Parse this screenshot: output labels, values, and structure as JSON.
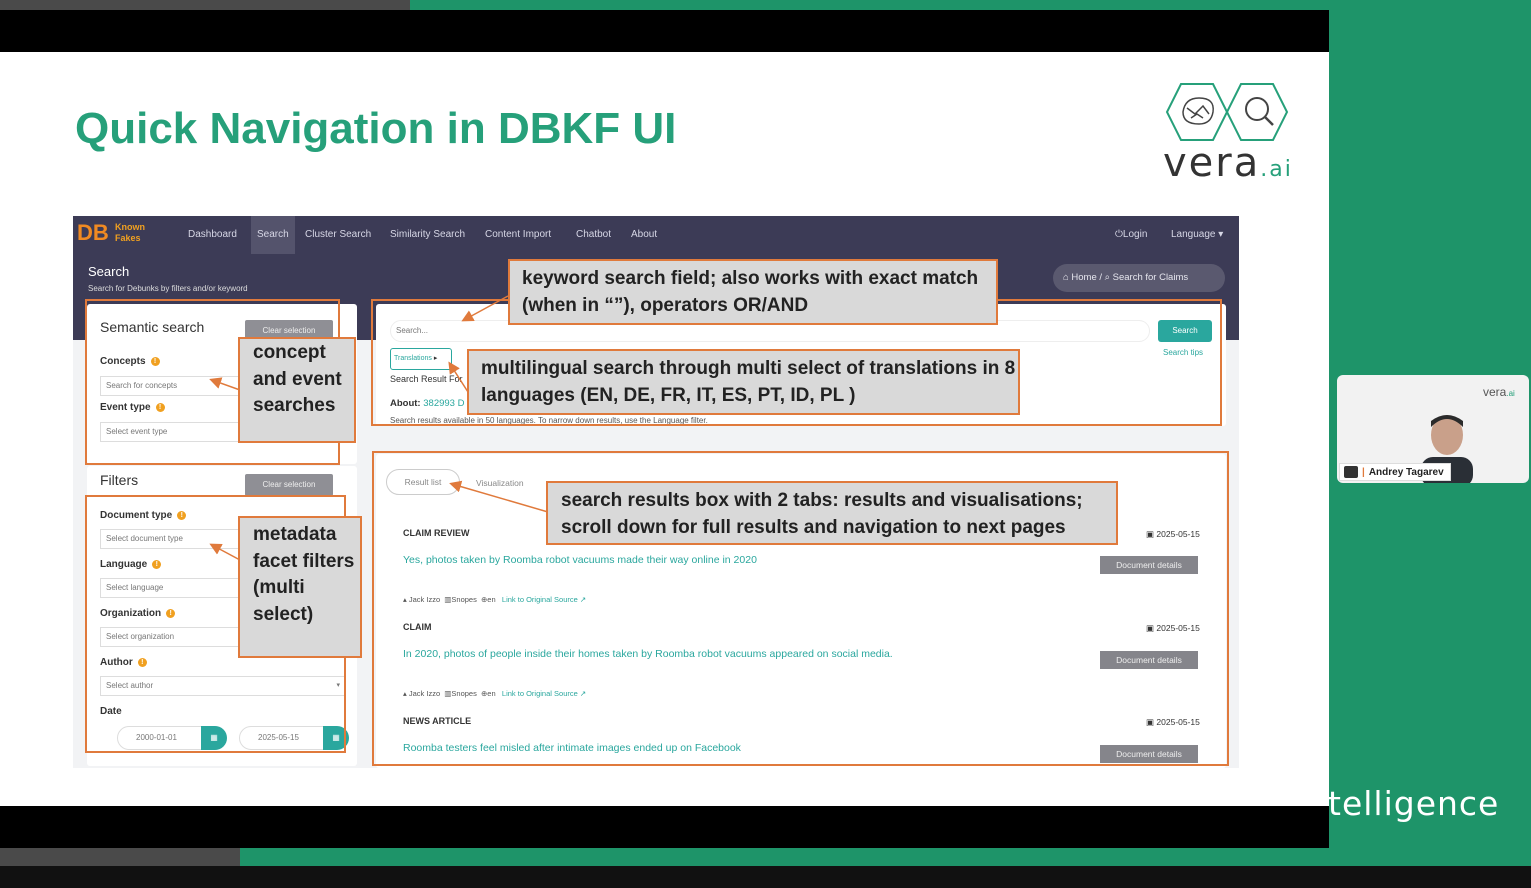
{
  "slide": {
    "title": "Quick Navigation in DBKF UI",
    "logo_word": "vera",
    "logo_suffix": ".ai",
    "footer_partial": "telligence"
  },
  "webcam": {
    "name": "Andrey Tagarev",
    "logo_word": "vera",
    "logo_suffix": ".ai"
  },
  "app": {
    "brand_short": "DB",
    "brand_line1": "Known",
    "brand_line2": "Fakes",
    "nav": [
      "Dashboard",
      "Search",
      "Cluster Search",
      "Similarity Search",
      "Content Import",
      "Chatbot",
      "About"
    ],
    "active_nav": "Search",
    "login": "Login",
    "language": "Language",
    "page_title": "Search",
    "page_subtitle": "Search for Debunks by filters and/or keyword",
    "breadcrumb_home": "Home",
    "breadcrumb_sep": "/",
    "breadcrumb_current": "Search for Claims"
  },
  "semantic": {
    "title": "Semantic search",
    "clear": "Clear selection",
    "concepts_label": "Concepts",
    "concepts_placeholder": "Search for concepts",
    "event_label": "Event type",
    "event_placeholder": "Select event type"
  },
  "filters": {
    "title": "Filters",
    "clear": "Clear selection",
    "doc_type_label": "Document type",
    "doc_type_placeholder": "Select document type",
    "language_label": "Language",
    "language_placeholder": "Select language",
    "org_label": "Organization",
    "org_placeholder": "Select organization",
    "author_label": "Author",
    "author_placeholder": "Select author",
    "date_label": "Date",
    "date_from": "2000-01-01",
    "date_to": "2025-05-15"
  },
  "search": {
    "placeholder": "Search...",
    "button": "Search",
    "tips": "Search tips",
    "translations": "Translations",
    "result_for": "Search Result For",
    "about_label": "About:",
    "about_count": "382993 D",
    "availability": "Search results available in 50 languages. To narrow down results, use the Language filter."
  },
  "results": {
    "tabs": [
      "Result list",
      "Visualization"
    ],
    "items": [
      {
        "kind": "CLAIM REVIEW",
        "date": "2025-05-15",
        "title": "Yes, photos taken by Roomba robot vacuums made their way online in 2020",
        "author": "Jack Izzo",
        "org": "Snopes",
        "lang": "en",
        "link": "Link to Original Source",
        "button": "Document details"
      },
      {
        "kind": "CLAIM",
        "date": "2025-05-15",
        "title": "In 2020, photos of people inside their homes taken by Roomba robot vacuums appeared on social media.",
        "author": "Jack Izzo",
        "org": "Snopes",
        "lang": "en",
        "link": "Link to Original Source",
        "button": "Document details"
      },
      {
        "kind": "NEWS ARTICLE",
        "date": "2025-05-15",
        "title": "Roomba testers feel misled after intimate images ended up on Facebook",
        "button": "Document details"
      }
    ]
  },
  "annotations": {
    "keyword": "keyword search field; also works with exact match (when in “”), operators OR/AND",
    "multilingual": "multilingual search through multi select of translations in 8 languages (EN, DE, FR, IT, ES, PT, ID, PL )",
    "concept": "concept and event searches",
    "metadata": "metadata facet filters (multi select)",
    "results": "search results box with 2 tabs: results and visualisations; scroll down for full results and navigation to next pages"
  }
}
